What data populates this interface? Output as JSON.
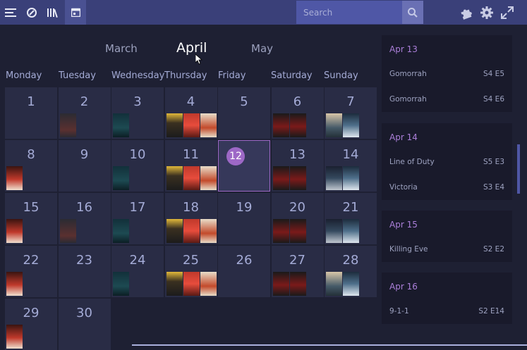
{
  "search": {
    "placeholder": "Search"
  },
  "months": {
    "prev": "March",
    "current": "April",
    "next": "May"
  },
  "weekdays": [
    "Monday",
    "Tuesday",
    "Wednesday",
    "Thursday",
    "Friday",
    "Saturday",
    "Sunday"
  ],
  "days": [
    {
      "n": "1",
      "posters": []
    },
    {
      "n": "2",
      "posters": [
        "show-b"
      ]
    },
    {
      "n": "3",
      "posters": [
        "show-c"
      ]
    },
    {
      "n": "4",
      "posters": [
        "show-d",
        "show-e",
        "show-f"
      ]
    },
    {
      "n": "5",
      "posters": []
    },
    {
      "n": "6",
      "posters": [
        "show-g",
        "show-g"
      ]
    },
    {
      "n": "7",
      "posters": [
        "show-h",
        "show-i"
      ]
    },
    {
      "n": "8",
      "posters": [
        "show-j"
      ]
    },
    {
      "n": "9",
      "posters": []
    },
    {
      "n": "10",
      "posters": [
        "show-c"
      ]
    },
    {
      "n": "11",
      "posters": [
        "show-d",
        "show-e",
        "show-f"
      ]
    },
    {
      "n": "12",
      "posters": [],
      "today": true
    },
    {
      "n": "13",
      "posters": [
        "show-g",
        "show-g"
      ]
    },
    {
      "n": "14",
      "posters": [
        "show-k",
        "show-i"
      ]
    },
    {
      "n": "15",
      "posters": [
        "show-j"
      ]
    },
    {
      "n": "16",
      "posters": [
        "show-b"
      ]
    },
    {
      "n": "17",
      "posters": [
        "show-c"
      ]
    },
    {
      "n": "18",
      "posters": [
        "show-d",
        "show-e",
        "show-f"
      ]
    },
    {
      "n": "19",
      "posters": []
    },
    {
      "n": "20",
      "posters": [
        "show-g",
        "show-g"
      ]
    },
    {
      "n": "21",
      "posters": [
        "show-k",
        "show-i"
      ]
    },
    {
      "n": "22",
      "posters": [
        "show-j"
      ]
    },
    {
      "n": "23",
      "posters": []
    },
    {
      "n": "24",
      "posters": [
        "show-c"
      ]
    },
    {
      "n": "25",
      "posters": [
        "show-d",
        "show-e",
        "show-f"
      ]
    },
    {
      "n": "26",
      "posters": []
    },
    {
      "n": "27",
      "posters": [
        "show-g",
        "show-g"
      ]
    },
    {
      "n": "28",
      "posters": [
        "show-h",
        "show-i"
      ]
    },
    {
      "n": "29",
      "posters": [
        "show-j"
      ]
    },
    {
      "n": "30",
      "posters": []
    }
  ],
  "agenda": [
    {
      "date": "Apr 13",
      "items": [
        {
          "title": "Gomorrah",
          "ep": "S4 E5"
        },
        {
          "title": "Gomorrah",
          "ep": "S4 E6"
        }
      ]
    },
    {
      "date": "Apr 14",
      "items": [
        {
          "title": "Line of Duty",
          "ep": "S5 E3"
        },
        {
          "title": "Victoria",
          "ep": "S3 E4"
        }
      ]
    },
    {
      "date": "Apr 15",
      "items": [
        {
          "title": "Killing Eve",
          "ep": "S2 E2"
        }
      ]
    },
    {
      "date": "Apr 16",
      "items": [
        {
          "title": "9-1-1",
          "ep": "S2 E14"
        }
      ]
    }
  ],
  "colors": {
    "topbar": "#3a4079",
    "accent": "#9d68c6",
    "cell": "#292c45"
  }
}
